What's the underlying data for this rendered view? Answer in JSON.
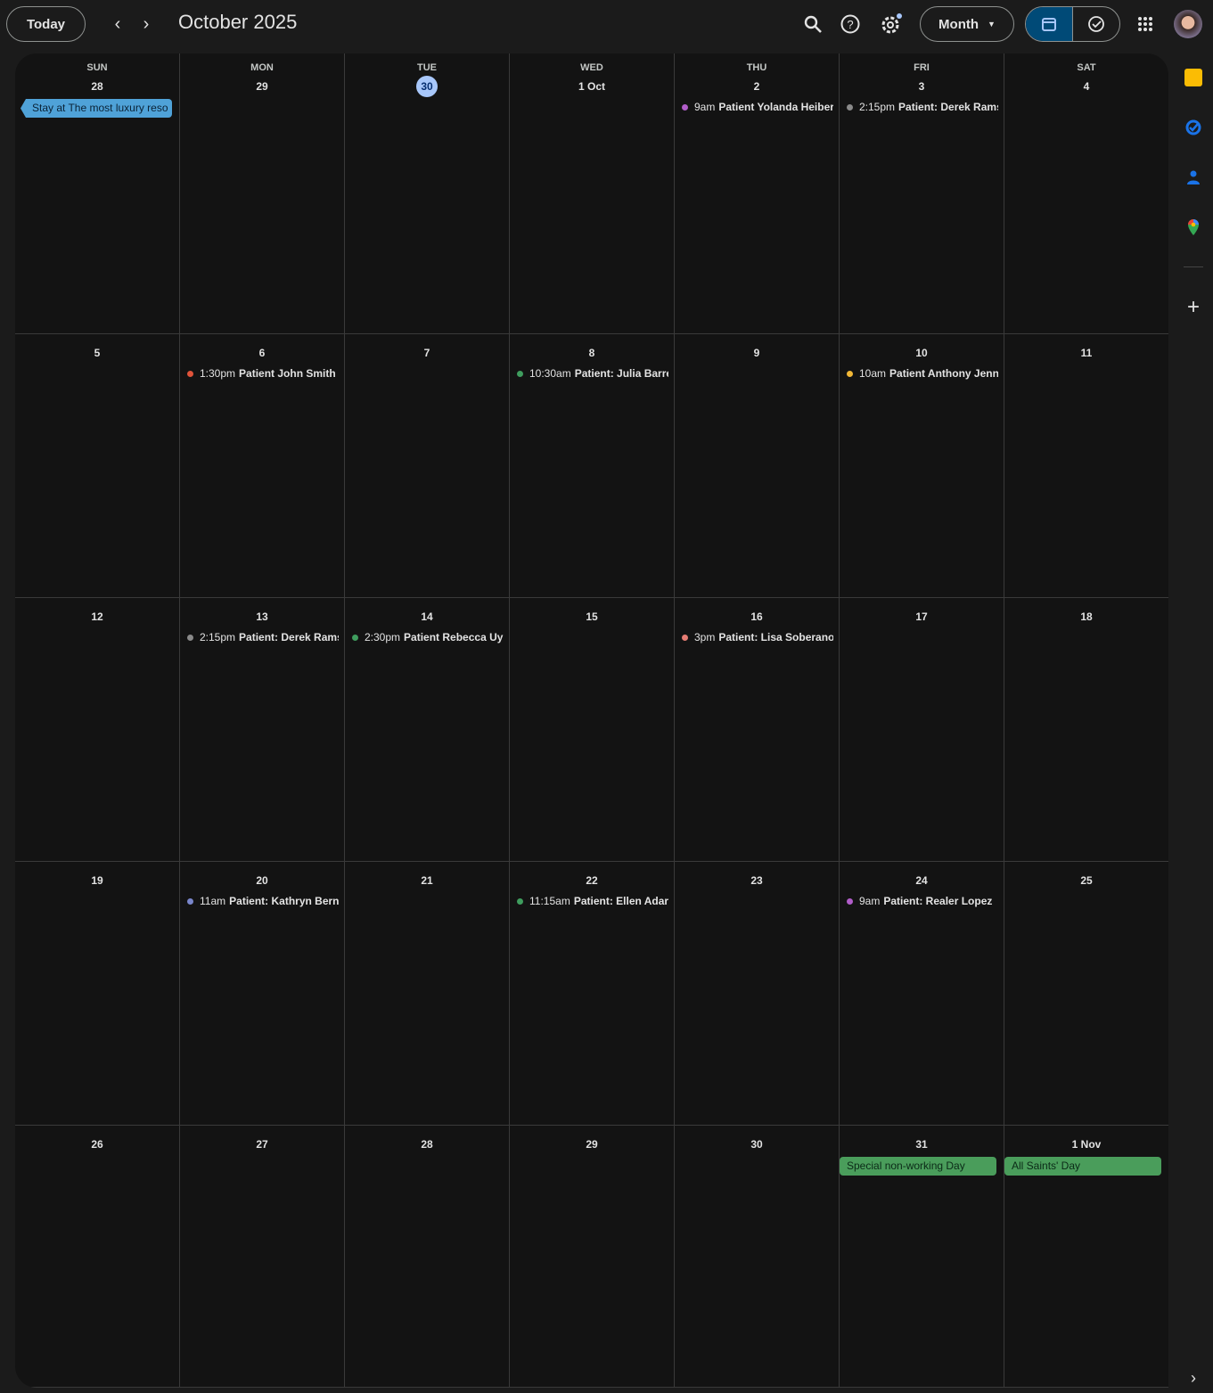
{
  "header": {
    "today": "Today",
    "title": "October 2025",
    "view": "Month"
  },
  "icons": [
    "search-icon",
    "help-icon",
    "settings-icon",
    "apps-icon"
  ],
  "weekdays": [
    "SUN",
    "MON",
    "TUE",
    "WED",
    "THU",
    "FRI",
    "SAT"
  ],
  "today_label": "30",
  "weeks": [
    [
      {
        "d": "28",
        "bar": {
          "t": "Stay at The most luxury reso",
          "c": "#4fa2d8"
        }
      },
      {
        "d": "29"
      },
      {
        "d": "30"
      },
      {
        "d": "1 Oct"
      },
      {
        "d": "2",
        "ev": [
          {
            "time": "9am",
            "t": "Patient Yolanda Heiber",
            "c": "#b15dc9"
          }
        ]
      },
      {
        "d": "3",
        "ev": [
          {
            "time": "2:15pm",
            "t": "Patient: Derek Ramsey",
            "c": "#8a8a8a"
          }
        ]
      },
      {
        "d": "4"
      }
    ],
    [
      {
        "d": "5"
      },
      {
        "d": "6",
        "ev": [
          {
            "time": "1:30pm",
            "t": "Patient John Smith",
            "c": "#e0533a"
          }
        ]
      },
      {
        "d": "7"
      },
      {
        "d": "8",
        "ev": [
          {
            "time": "10:30am",
            "t": "Patient: Julia Barre",
            "c": "#3f9d5e"
          }
        ]
      },
      {
        "d": "9"
      },
      {
        "d": "10",
        "ev": [
          {
            "time": "10am",
            "t": "Patient Anthony Jenn",
            "c": "#f2b836"
          }
        ]
      },
      {
        "d": "11"
      }
    ],
    [
      {
        "d": "12"
      },
      {
        "d": "13",
        "ev": [
          {
            "time": "2:15pm",
            "t": "Patient: Derek Ramsey",
            "c": "#8a8a8a"
          }
        ]
      },
      {
        "d": "14",
        "ev": [
          {
            "time": "2:30pm",
            "t": "Patient Rebecca Uy",
            "c": "#3f9d5e"
          }
        ]
      },
      {
        "d": "15"
      },
      {
        "d": "16",
        "ev": [
          {
            "time": "3pm",
            "t": "Patient: Lisa Soberano",
            "c": "#e67c73"
          }
        ]
      },
      {
        "d": "17"
      },
      {
        "d": "18"
      }
    ],
    [
      {
        "d": "19"
      },
      {
        "d": "20",
        "ev": [
          {
            "time": "11am",
            "t": "Patient: Kathryn Bernardo",
            "c": "#7986cb"
          }
        ]
      },
      {
        "d": "21"
      },
      {
        "d": "22",
        "ev": [
          {
            "time": "11:15am",
            "t": "Patient: Ellen Adarna",
            "c": "#3f9d5e"
          }
        ]
      },
      {
        "d": "23"
      },
      {
        "d": "24",
        "ev": [
          {
            "time": "9am",
            "t": "Patient: Realer Lopez",
            "c": "#b15dc9"
          }
        ]
      },
      {
        "d": "25"
      }
    ],
    [
      {
        "d": "26"
      },
      {
        "d": "27"
      },
      {
        "d": "28"
      },
      {
        "d": "29"
      },
      {
        "d": "30"
      },
      {
        "d": "31",
        "bar": {
          "t": "Special non-working Day",
          "c": "#4a9d5b"
        }
      },
      {
        "d": "1 Nov",
        "bar": {
          "t": "All Saints' Day",
          "c": "#4a9d5b"
        }
      }
    ]
  ]
}
